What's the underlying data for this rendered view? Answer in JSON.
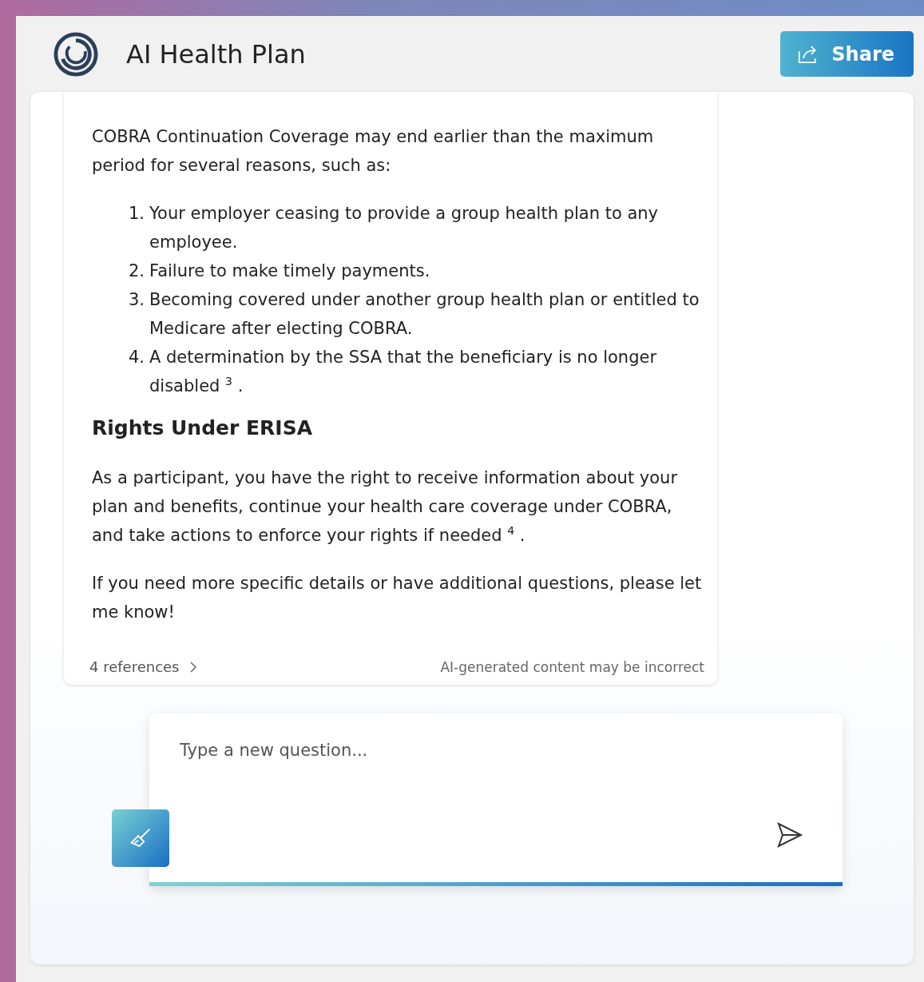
{
  "header": {
    "title": "AI Health Plan",
    "share_label": "Share"
  },
  "message": {
    "intro": "COBRA Continuation Coverage may end earlier than the maximum period for several reasons, such as:",
    "list": [
      {
        "number": "1.",
        "text": "Your employer ceasing to provide a group health plan to any employee."
      },
      {
        "number": "2.",
        "text": "Failure to make timely payments."
      },
      {
        "number": "3.",
        "text": "Becoming covered under another group health plan or entitled to Medicare after electing COBRA."
      },
      {
        "number": "4.",
        "text": "A determination by the SSA that the beneficiary is no longer disabled $^{3}$ ."
      }
    ],
    "heading": "Rights Under ERISA",
    "paragraphs": [
      "As a participant, you have the right to receive information about your plan and benefits, continue your health care coverage under COBRA, and take actions to enforce your rights if needed $^{4}$ .",
      "If you need more specific details or have additional questions, please let me know!"
    ],
    "references": "4 references",
    "disclaimer": "AI-generated content may be incorrect"
  },
  "input": {
    "placeholder": "Type a new question..."
  }
}
